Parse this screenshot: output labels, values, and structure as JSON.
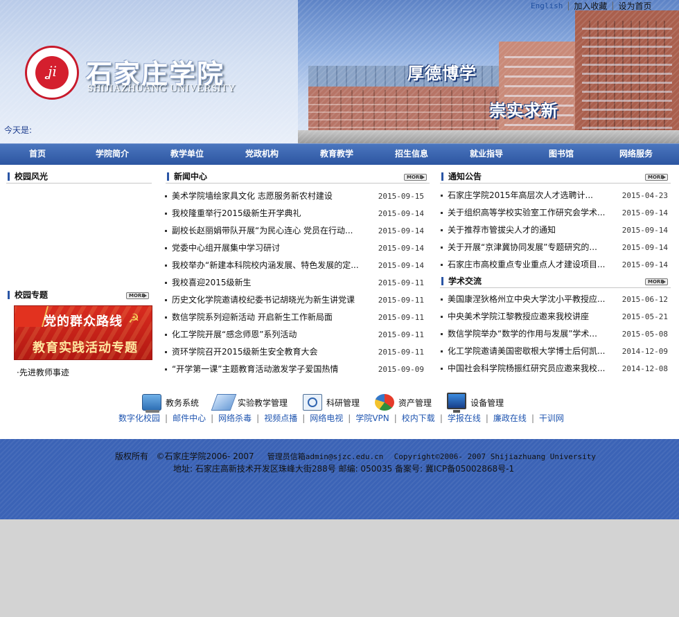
{
  "header": {
    "logo_cn": "石家庄学院",
    "logo_en": "SHIJIAZHUANG UNIVERSITY",
    "motto_1": "厚德博学",
    "motto_2": "崇实求新",
    "today_label": "今天是:",
    "top_links": [
      "English",
      "加入收藏",
      "设为首页"
    ]
  },
  "nav": [
    "首页",
    "学院简介",
    "教学单位",
    "党政机构",
    "教育教学",
    "招生信息",
    "就业指导",
    "图书馆",
    "网络服务"
  ],
  "campus_scenery": {
    "title": "校园风光"
  },
  "campus_topics": {
    "title": "校园专题",
    "more": "MORE",
    "banner_line1": "党的群众路线",
    "banner_line2": "教育实践活动专题",
    "link": "·先进教师事迹"
  },
  "news_center": {
    "title": "新闻中心",
    "more": "MORE",
    "items": [
      {
        "title": "美术学院墙绘家具文化 志愿服务新农村建设",
        "date": "2015-09-15"
      },
      {
        "title": "我校隆重举行2015级新生开学典礼",
        "date": "2015-09-14"
      },
      {
        "title": "副校长赵丽娟带队开展“为民心连心 党员在行动...",
        "date": "2015-09-14"
      },
      {
        "title": "党委中心组开展集中学习研讨",
        "date": "2015-09-14"
      },
      {
        "title": "我校举办“新建本科院校内涵发展、特色发展的定...",
        "date": "2015-09-14"
      },
      {
        "title": "我校喜迎2015级新生",
        "date": "2015-09-11"
      },
      {
        "title": "历史文化学院邀请校纪委书记胡晓光为新生讲党课",
        "date": "2015-09-11"
      },
      {
        "title": "数信学院系列迎新活动 开启新生工作新局面",
        "date": "2015-09-11"
      },
      {
        "title": "化工学院开展“感念师恩”系列活动",
        "date": "2015-09-11"
      },
      {
        "title": "资环学院召开2015级新生安全教育大会",
        "date": "2015-09-11"
      },
      {
        "title": "“开学第一课”主题教育活动激发学子爱国热情",
        "date": "2015-09-09"
      }
    ]
  },
  "notices": {
    "title": "通知公告",
    "more": "MORE",
    "items": [
      {
        "title": "石家庄学院2015年高层次人才选聘计...",
        "date": "2015-04-23"
      },
      {
        "title": "关于组织高等学校实验室工作研究会学术...",
        "date": "2015-09-14"
      },
      {
        "title": "关于推荐市管拔尖人才的通知",
        "date": "2015-09-14"
      },
      {
        "title": "关于开展“京津冀协同发展”专题研究的...",
        "date": "2015-09-14"
      },
      {
        "title": "石家庄市高校重点专业重点人才建设项目...",
        "date": "2015-09-14"
      }
    ]
  },
  "academic": {
    "title": "学术交流",
    "more": "MORE",
    "items": [
      {
        "title": "美国康涅狄格州立中央大学沈小平教授应...",
        "date": "2015-06-12"
      },
      {
        "title": "中央美术学院江黎教授应邀来我校讲座",
        "date": "2015-05-21"
      },
      {
        "title": "数信学院举办“数学的作用与发展”学术...",
        "date": "2015-05-08"
      },
      {
        "title": "化工学院邀请美国密歇根大学博士后何凯...",
        "date": "2014-12-09"
      },
      {
        "title": "中国社会科学院杨振红研究员应邀来我校...",
        "date": "2014-12-08"
      }
    ]
  },
  "systems": [
    {
      "label": "教务系统",
      "icon": "computer-icon"
    },
    {
      "label": "实验教学管理",
      "icon": "document-icon"
    },
    {
      "label": "科研管理",
      "icon": "magnifier-icon"
    },
    {
      "label": "资产管理",
      "icon": "pie-chart-icon"
    },
    {
      "label": "设备管理",
      "icon": "monitor-icon"
    }
  ],
  "quick_links": [
    "数字化校园",
    "邮件中心",
    "网络杀毒",
    "视频点播",
    "网络电视",
    "学院VPN",
    "校内下载",
    "学报在线",
    "廉政在线",
    "干训网"
  ],
  "footer": {
    "line1_label": "版权所有",
    "line1_copy": "©石家庄学院2006- 2007",
    "line1_admin": "管理员信箱admin@sjzc.edu.cn",
    "line1_en": "Copyright©2006- 2007 Shijiazhuang University",
    "line2": "地址: 石家庄高新技术开发区珠峰大街288号 邮编: 050035 备案号: 冀ICP备05002868号-1"
  },
  "colors": {
    "nav": "#2c55a1",
    "footer": "#3b63b6",
    "link": "#1f55b0",
    "seal": "#d41f2e"
  }
}
